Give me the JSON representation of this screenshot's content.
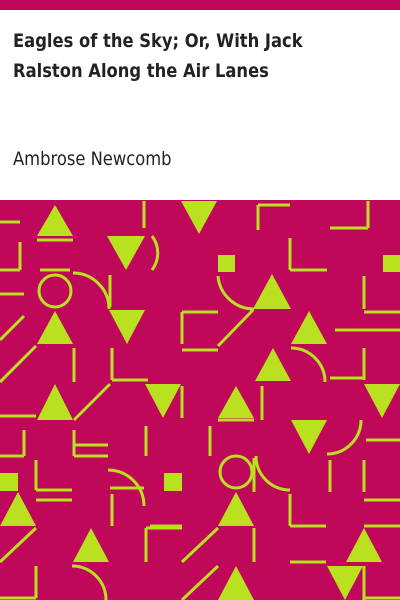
{
  "book": {
    "title": "Eagles of the Sky; Or, With Jack Ralston Along the Air Lanes",
    "author": "Ambrose Newcomb"
  },
  "colors": {
    "accent": "#c0085a",
    "pattern_background": "#c0085a",
    "pattern_foreground": "#b9e11f",
    "text": "#222222",
    "page": "#ffffff"
  }
}
